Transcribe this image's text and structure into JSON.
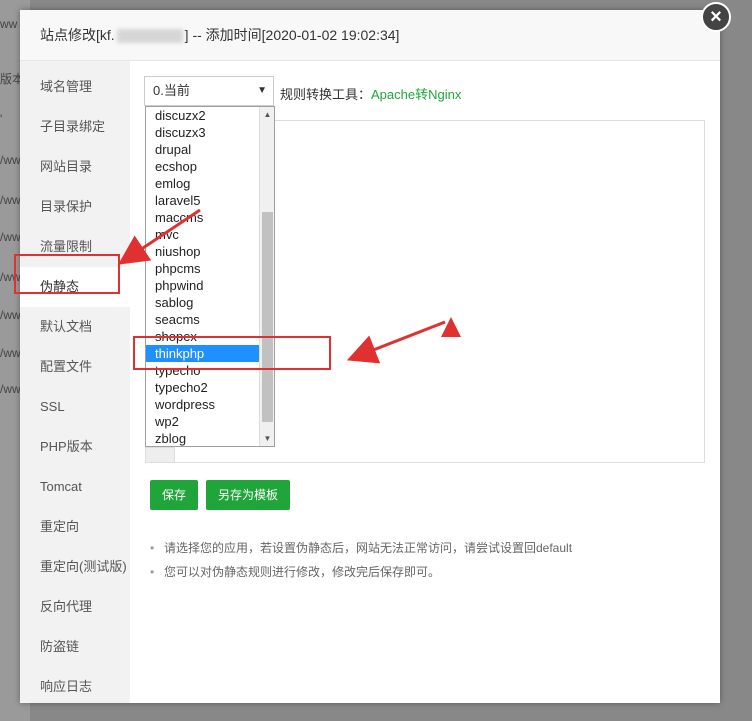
{
  "background": {
    "row_texts": [
      "ww",
      "版本",
      "'",
      "/ww",
      "/ww",
      "/ww",
      "/ww",
      "/ww",
      "/ww",
      "/ww"
    ]
  },
  "dialog": {
    "title_prefix": "站点修改[kf.",
    "title_suffix": "] -- 添加时间[2020-01-02 19:02:34]",
    "close_label": "×"
  },
  "sidebar": {
    "items": [
      {
        "label": "域名管理"
      },
      {
        "label": "子目录绑定"
      },
      {
        "label": "网站目录"
      },
      {
        "label": "目录保护"
      },
      {
        "label": "流量限制"
      },
      {
        "label": "伪静态"
      },
      {
        "label": "默认文档"
      },
      {
        "label": "配置文件"
      },
      {
        "label": "SSL"
      },
      {
        "label": "PHP版本"
      },
      {
        "label": "Tomcat"
      },
      {
        "label": "重定向"
      },
      {
        "label": "重定向(测试版)"
      },
      {
        "label": "反向代理"
      },
      {
        "label": "防盗链"
      },
      {
        "label": "响应日志"
      }
    ],
    "active_index": 5
  },
  "rewrite": {
    "selected_value": "0.当前",
    "tool_label": "规则转换工具：",
    "tool_link": "Apache转Nginx",
    "options": [
      "discuzx2",
      "discuzx3",
      "drupal",
      "ecshop",
      "emlog",
      "laravel5",
      "maccms",
      "mvc",
      "niushop",
      "phpcms",
      "phpwind",
      "sablog",
      "seacms",
      "shopex",
      "thinkphp",
      "typecho",
      "typecho2",
      "wordpress",
      "wp2",
      "zblog"
    ],
    "highlighted_option": "thinkphp",
    "save_label": "保存",
    "save_template_label": "另存为模板",
    "tips": [
      "请选择您的应用，若设置伪静态后，网站无法正常访问，请尝试设置回default",
      "您可以对伪静态规则进行修改，修改完后保存即可。"
    ]
  },
  "colors": {
    "accent_green": "#20a53a",
    "selection_blue": "#1e90ff",
    "annotation_red": "#e03131"
  }
}
